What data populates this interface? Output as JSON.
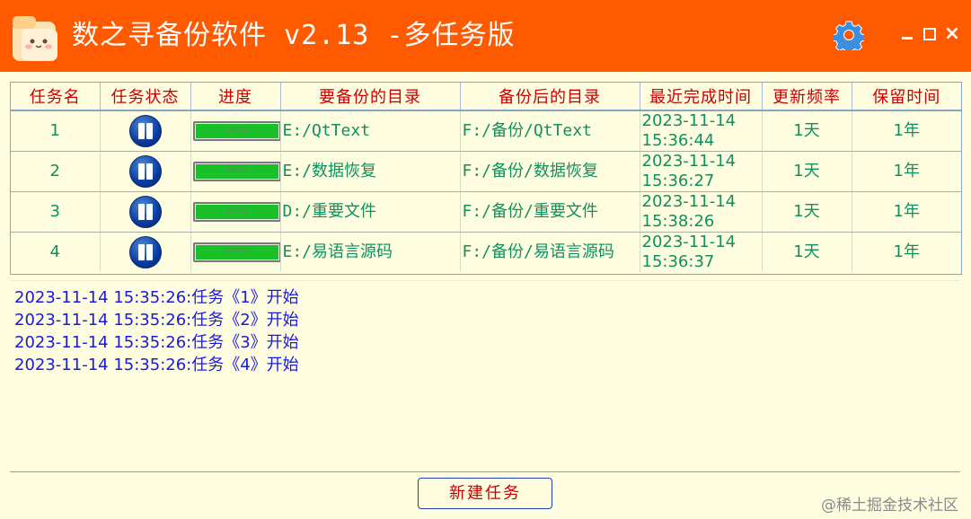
{
  "window": {
    "title": "数之寻备份软件 v2.13 -多任务版",
    "accent_color": "#ff5a00",
    "controls": {
      "minimize_icon": "minimize-icon",
      "maximize_icon": "maximize-icon",
      "close_label": "×"
    },
    "settings_icon": "gear-icon"
  },
  "table": {
    "columns": [
      "任务名",
      "任务状态",
      "进度",
      "要备份的目录",
      "备份后的目录",
      "最近完成时间",
      "更新频率",
      "保留时间"
    ],
    "rows": [
      {
        "name": "1",
        "status_icon": "pause-icon",
        "progress": 100,
        "progress_label": "100%",
        "source": "E:/QtText",
        "target": "F:/备份/QtText",
        "date": "2023-11-14",
        "time": "15:36:44",
        "frequency": "1天",
        "retention": "1年"
      },
      {
        "name": "2",
        "status_icon": "pause-icon",
        "progress": 100,
        "progress_label": "100%",
        "source": "E:/数据恢复",
        "target": "F:/备份/数据恢复",
        "date": "2023-11-14",
        "time": "15:36:27",
        "frequency": "1天",
        "retention": "1年"
      },
      {
        "name": "3",
        "status_icon": "pause-icon",
        "progress": 100,
        "progress_label": "100%",
        "source": "D:/重要文件",
        "target": "F:/备份/重要文件",
        "date": "2023-11-14",
        "time": "15:38:26",
        "frequency": "1天",
        "retention": "1年"
      },
      {
        "name": "4",
        "status_icon": "pause-icon",
        "progress": 100,
        "progress_label": "100%",
        "source": "E:/易语言源码",
        "target": "F:/备份/易语言源码",
        "date": "2023-11-14",
        "time": "15:36:37",
        "frequency": "1天",
        "retention": "1年"
      }
    ]
  },
  "log": {
    "lines": [
      "2023-11-14 15:35:26:任务《1》开始",
      "2023-11-14 15:35:26:任务《2》开始",
      "2023-11-14 15:35:26:任务《3》开始",
      "2023-11-14 15:35:26:任务《4》开始"
    ]
  },
  "footer": {
    "new_task_label": "新建任务",
    "watermark": "@稀土掘金技术社区"
  }
}
